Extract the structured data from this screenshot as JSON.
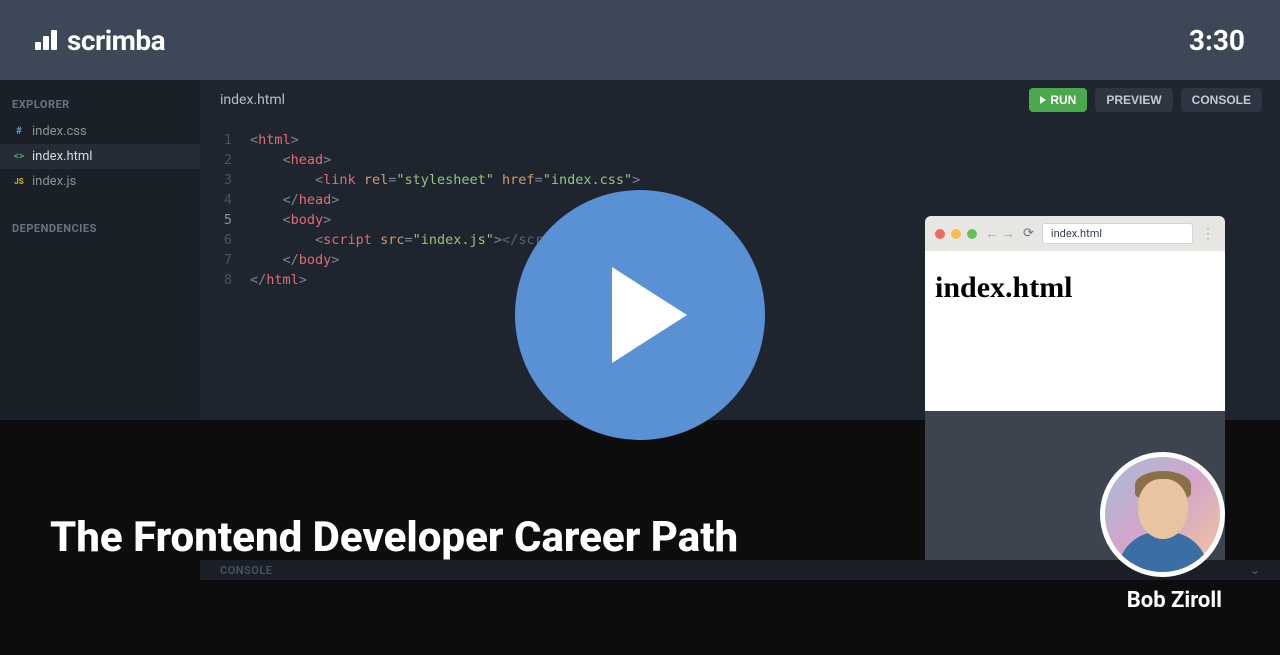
{
  "header": {
    "brand": "scrimba",
    "timer": "3:30"
  },
  "sidebar": {
    "explorer_label": "EXPLORER",
    "dependencies_label": "DEPENDENCIES",
    "files": [
      {
        "name": "index.css",
        "type": "css",
        "icon": "#"
      },
      {
        "name": "index.html",
        "type": "html",
        "icon": "<>"
      },
      {
        "name": "index.js",
        "type": "js",
        "icon": "JS"
      }
    ]
  },
  "editor": {
    "active_tab": "index.html",
    "buttons": {
      "run": "RUN",
      "preview": "PREVIEW",
      "console": "CONSOLE"
    },
    "line_numbers": [
      "1",
      "2",
      "3",
      "4",
      "5",
      "6",
      "7",
      "8"
    ]
  },
  "code": {
    "l1_tag": "html",
    "l2_tag": "head",
    "l3_tag": "link",
    "l3_attr1": "rel",
    "l3_val1": "\"stylesheet\"",
    "l3_attr2": "href",
    "l3_val2": "\"index.css\"",
    "l4_tag": "head",
    "l5_tag": "body",
    "l6_tag": "script",
    "l6_attr": "src",
    "l6_val": "\"index.js\"",
    "l6_close": "script",
    "l7_tag": "body",
    "l8_tag": "html"
  },
  "preview": {
    "url": "index.html",
    "heading": "index.html"
  },
  "console": {
    "label": "CONSOLE"
  },
  "course": {
    "title": "The Frontend Developer Career Path",
    "instructor": "Bob Ziroll"
  }
}
